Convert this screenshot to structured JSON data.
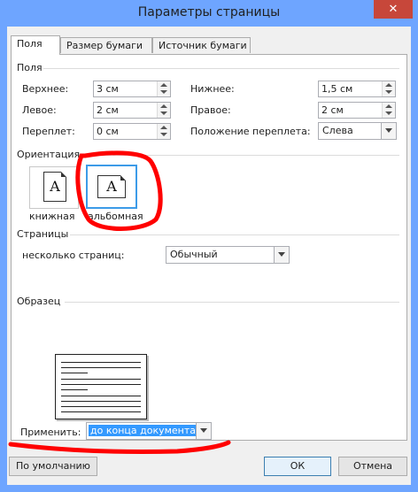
{
  "window": {
    "title": "Параметры страницы",
    "close_glyph": "✕"
  },
  "tabs": [
    {
      "label": "Поля"
    },
    {
      "label": "Размер бумаги"
    },
    {
      "label": "Источник бумаги"
    }
  ],
  "margins_group": {
    "title": "Поля",
    "top": {
      "label": "Верхнее:",
      "value": "3 см"
    },
    "bottom": {
      "label": "Нижнее:",
      "value": "1,5 см"
    },
    "left": {
      "label": "Левое:",
      "value": "2 см"
    },
    "right": {
      "label": "Правое:",
      "value": "2 см"
    },
    "gutter": {
      "label": "Переплет:",
      "value": "0 см"
    },
    "gutter_pos": {
      "label": "Положение переплета:",
      "value": "Слева"
    }
  },
  "orientation_group": {
    "title": "Ориентация",
    "portrait": {
      "label": "книжная",
      "glyph": "A"
    },
    "landscape": {
      "label": "альбомная",
      "glyph": "A"
    }
  },
  "pages_group": {
    "title": "Страницы",
    "multiple_label": "несколько страниц:",
    "multiple_value": "Обычный"
  },
  "preview_group": {
    "title": "Образец"
  },
  "apply": {
    "label": "Применить:",
    "value": "до конца документа"
  },
  "buttons": {
    "default": "По умолчанию",
    "ok": "ОК",
    "cancel": "Отмена"
  },
  "colors": {
    "titlebar": "#6ea5ff",
    "close": "#c7473a",
    "annotation": "#ff0000",
    "selection": "#3399ff"
  }
}
